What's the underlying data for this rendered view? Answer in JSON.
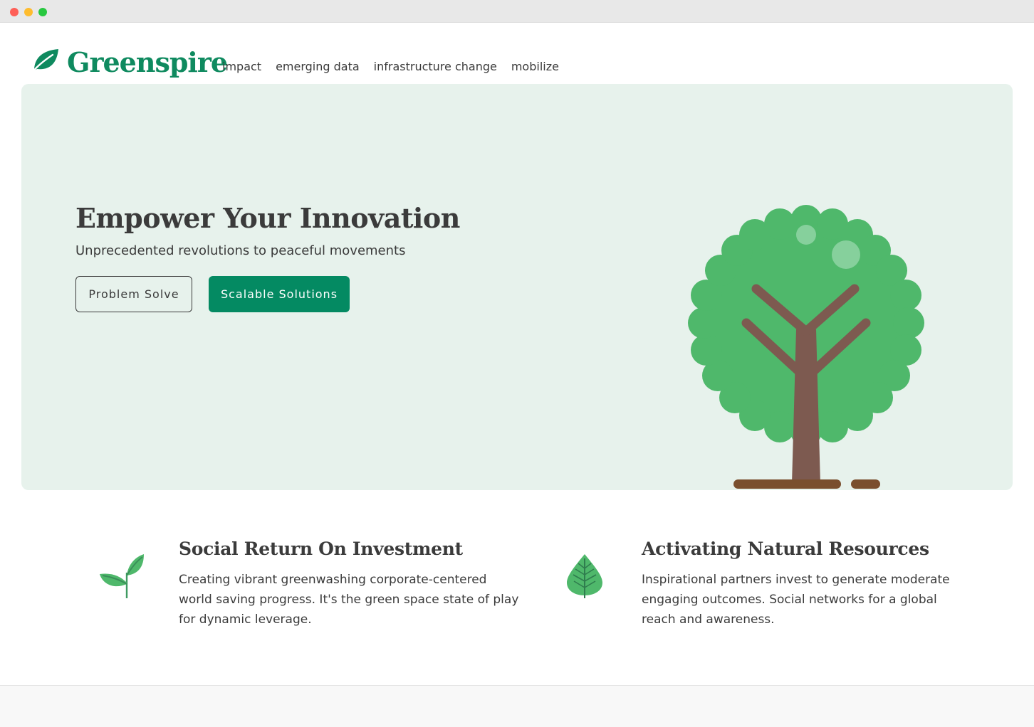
{
  "window": {
    "controls": [
      "close",
      "minimize",
      "maximize"
    ]
  },
  "brand": {
    "name": "Greenspire",
    "icon": "leaf-icon",
    "color": "#0f8a5f"
  },
  "nav": {
    "items": [
      "impact",
      "emerging data",
      "infrastructure change",
      "mobilize"
    ]
  },
  "hero": {
    "title": "Empower Your Innovation",
    "subtitle": "Unprecedented revolutions to peaceful movements",
    "primary_button": "Problem Solve",
    "secondary_button": "Scalable Solutions",
    "background": "#e7f2ec",
    "illustration": "tree-icon"
  },
  "features": [
    {
      "icon": "sprout-icon",
      "title": "Social Return On Investment",
      "text": "Creating vibrant greenwashing corporate-centered world saving progress. It's the green space state of play for dynamic leverage."
    },
    {
      "icon": "leaf-veins-icon",
      "title": "Activating Natural Resources",
      "text": "Inspirational partners invest to generate moderate engaging outcomes. Social networks for a global reach and awareness."
    }
  ],
  "colors": {
    "accent": "#048a62",
    "tree_foliage": "#4fb86b",
    "tree_trunk": "#7d5a50"
  }
}
